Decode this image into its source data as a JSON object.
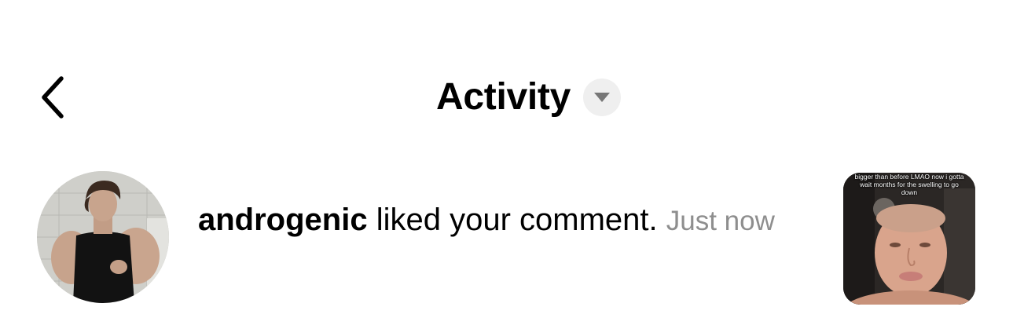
{
  "header": {
    "title": "Activity",
    "back_icon": "chevron-left-icon",
    "dropdown_icon": "caret-down-icon"
  },
  "notification": {
    "username": "androgenic",
    "action": "liked your comment.",
    "time": "Just now",
    "thumbnail_caption": "bigger than before LMAO now i gotta wait months for the swelling to go down"
  },
  "colors": {
    "background": "#ffffff",
    "text": "#000000",
    "muted": "#8e8e8e",
    "dropdown_bg": "#efefef"
  }
}
